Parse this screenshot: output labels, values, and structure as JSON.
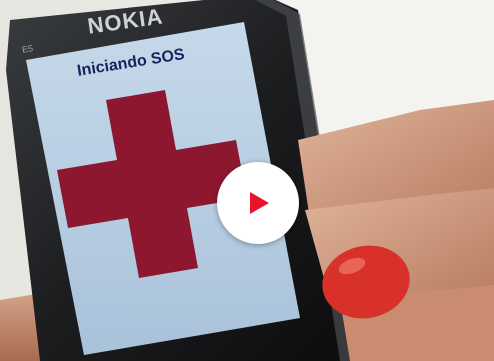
{
  "phone": {
    "brand": "NOKIA",
    "side_mark": "E5"
  },
  "screen": {
    "title": "Iniciando SOS",
    "symbol": "red-cross-icon",
    "background_color": "#b8cfe2",
    "symbol_color": "#8e1730"
  },
  "overlay": {
    "icon": "play-icon",
    "button_color": "#ffffff",
    "icon_color": "#e6142b"
  }
}
